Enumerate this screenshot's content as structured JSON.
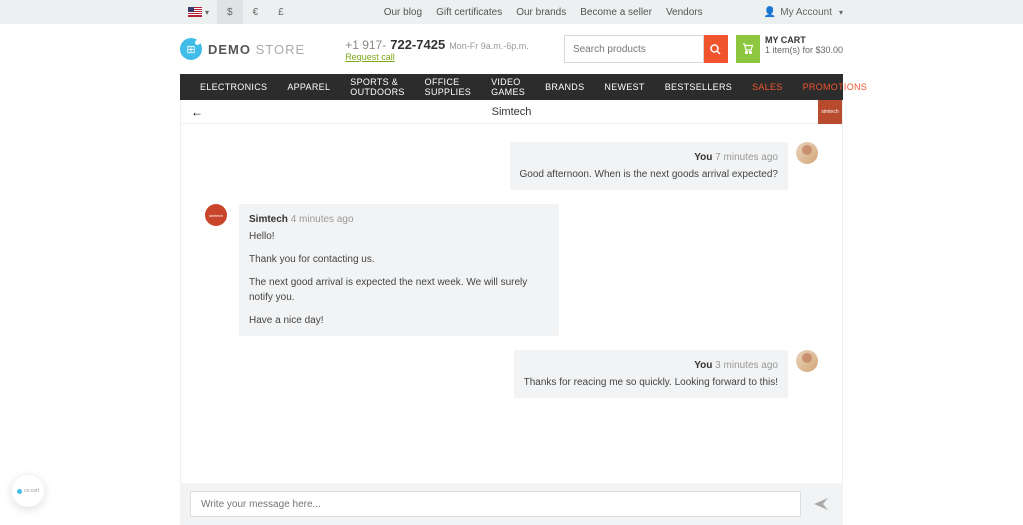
{
  "topbar": {
    "currencies": [
      "$",
      "€",
      "£"
    ],
    "links": [
      "Our blog",
      "Gift certificates",
      "Our brands",
      "Become a seller",
      "Vendors"
    ],
    "account": "My Account"
  },
  "header": {
    "logo_bold": "DEMO",
    "logo_light": "STORE",
    "phone_prefix": "+1 917-",
    "phone_main": "722-7425",
    "phone_hours": "Mon-Fr 9a.m.-6p.m.",
    "request_call": "Request call",
    "search_placeholder": "Search products",
    "cart_title": "MY CART",
    "cart_items": "1 item(s) for $30.00"
  },
  "nav": {
    "items": [
      "ELECTRONICS",
      "APPAREL",
      "SPORTS & OUTDOORS",
      "OFFICE SUPPLIES",
      "VIDEO GAMES",
      "BRANDS",
      "NEWEST",
      "BESTSELLERS"
    ],
    "sales": "SALES",
    "promo": "PROMOTIONS"
  },
  "chat": {
    "title": "Simtech",
    "badge": "simtech",
    "messages": [
      {
        "side": "right",
        "name": "You",
        "time": "7 minutes ago",
        "lines": [
          "Good afternoon. When is the next goods arrival expected?"
        ]
      },
      {
        "side": "left",
        "name": "Simtech",
        "time": "4 minutes ago",
        "lines": [
          "Hello!",
          "Thank you for contacting us.",
          "The next good arrival is expected the next week. We will surely notify you.",
          "Have a nice day!"
        ]
      },
      {
        "side": "right",
        "name": "You",
        "time": "3 minutes ago",
        "lines": [
          "Thanks for reacing me so quickly. Looking forward to this!"
        ]
      }
    ],
    "input_placeholder": "Write your message here..."
  },
  "floating": "cs-cart"
}
